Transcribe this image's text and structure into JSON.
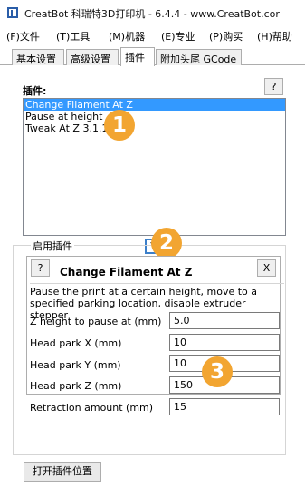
{
  "window": {
    "title": "CreatBot 科瑞特3D打印机 - 6.4.4 - www.CreatBot.cor"
  },
  "menu": [
    {
      "label": "(F)文件"
    },
    {
      "label": "(T)工具"
    },
    {
      "label": "(M)机器"
    },
    {
      "label": "(E)专业"
    },
    {
      "label": "(P)购买"
    },
    {
      "label": "(H)帮助"
    }
  ],
  "tabs": [
    {
      "label": "基本设置"
    },
    {
      "label": "高级设置"
    },
    {
      "label": "插件",
      "active": true
    },
    {
      "label": "附加头尾 GCode"
    }
  ],
  "plugins": {
    "label": "插件:",
    "help_label": "?",
    "items": [
      {
        "label": "Change Filament At Z",
        "selected": true
      },
      {
        "label": "Pause at height"
      },
      {
        "label": "Tweak At Z 3.1.1"
      }
    ]
  },
  "add_button_label": "V",
  "enabled_plugins": {
    "group_label": "启用插件",
    "help_label": "?",
    "close_label": "X",
    "title": "Change Filament At Z",
    "description": "Pause the print at a certain height, move to a specified parking location, disable extruder stepper",
    "fields": [
      {
        "label": "Z height to pause at (mm)",
        "value": "5.0"
      },
      {
        "label": "Head park X (mm)",
        "value": "10"
      },
      {
        "label": "Head park Y (mm)",
        "value": "10"
      },
      {
        "label": "Head park Z (mm)",
        "value": "150"
      },
      {
        "label": "Retraction amount (mm)",
        "value": "15"
      }
    ]
  },
  "open_location_label": "打开插件位置",
  "annotations": {
    "badge_1": "1",
    "badge_2": "2",
    "badge_3": "3"
  },
  "colors": {
    "badge": "#f2a531",
    "selection": "#3399ff",
    "add_button_border": "#3c7fc9"
  }
}
